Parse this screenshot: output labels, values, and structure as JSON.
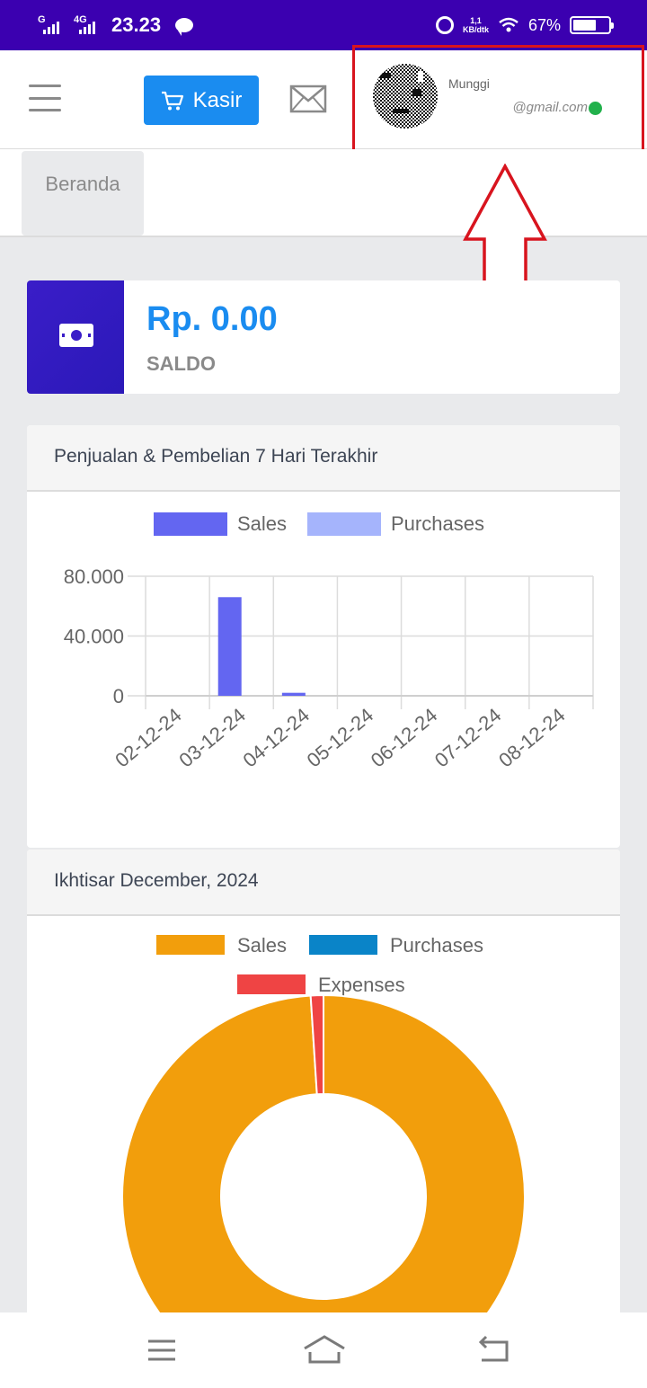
{
  "status_bar": {
    "network1": "G",
    "network2": "4G",
    "time": "23.23",
    "speed_value": "1,1",
    "speed_unit": "KB/dtk",
    "battery_percent": "67%",
    "battery_level": 0.67
  },
  "header": {
    "kasir_label": "Kasir",
    "profile_name": "Munggi",
    "profile_email": "@gmail.com",
    "online_color": "#22b14c"
  },
  "tabs": [
    {
      "label": "Beranda"
    }
  ],
  "saldo": {
    "amount": "Rp. 0.00",
    "label": "SALDO"
  },
  "colors": {
    "accent": "#1a8cf0",
    "status_bar": "#3b00b0",
    "annotation": "#d8141e",
    "sales_bar": "#6366f1",
    "purchases_bar": "#a5b4fc",
    "sales_donut": "#f29e0c",
    "purchases_donut": "#0a84c8",
    "expenses_donut": "#ef4444"
  },
  "weekly_card": {
    "title": "Penjualan & Pembelian 7 Hari Terakhir"
  },
  "summary_card": {
    "title": "Ikhtisar December, 2024"
  },
  "chart_data": [
    {
      "type": "bar",
      "categories": [
        "02-12-24",
        "03-12-24",
        "04-12-24",
        "05-12-24",
        "06-12-24",
        "07-12-24",
        "08-12-24"
      ],
      "series": [
        {
          "name": "Sales",
          "values": [
            0,
            66000,
            2000,
            0,
            0,
            0,
            0
          ]
        },
        {
          "name": "Purchases",
          "values": [
            0,
            0,
            0,
            0,
            0,
            0,
            0
          ]
        }
      ],
      "yticks": [
        "0",
        "40.000",
        "80.000"
      ],
      "ylim": [
        0,
        80000
      ],
      "legend": "top",
      "grid": true
    },
    {
      "type": "pie",
      "labels": [
        "Sales",
        "Purchases",
        "Expenses"
      ],
      "values": [
        68000,
        0,
        700
      ],
      "donut": true,
      "legend": "top"
    }
  ],
  "nav": {
    "menu_icon": "menu-icon",
    "home_icon": "home-icon",
    "back_icon": "back-icon"
  }
}
